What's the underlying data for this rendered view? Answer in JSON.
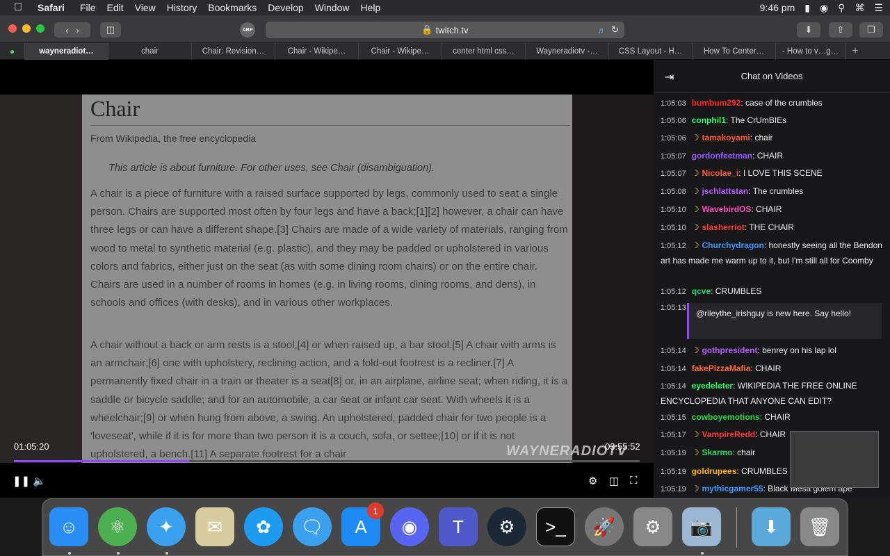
{
  "menubar": {
    "app": "Safari",
    "items": [
      "File",
      "Edit",
      "View",
      "History",
      "Bookmarks",
      "Develop",
      "Window",
      "Help"
    ],
    "clock": "9:46 pm"
  },
  "toolbar": {
    "url": "twitch.tv",
    "abp": "ABP"
  },
  "tabs": [
    {
      "label": "wayneradiot…",
      "active": true
    },
    {
      "label": "chair"
    },
    {
      "label": "Chair: Revision…"
    },
    {
      "label": "Chair - Wikipe…"
    },
    {
      "label": "Chair - Wikipe…"
    },
    {
      "label": "center html css…"
    },
    {
      "label": "Wayneradiotv -…"
    },
    {
      "label": "CSS Layout - H…"
    },
    {
      "label": "How To Center…"
    },
    {
      "label": "- How to v…g…"
    }
  ],
  "video": {
    "page_title": "Chair",
    "page_sub": "From Wikipedia, the free encyclopedia",
    "page_note": "This article is about furniture. For other uses, see Chair (disambiguation).",
    "para1": "A chair is a piece of furniture with a raised surface supported by legs, commonly used to seat a single person. Chairs are supported most often by four legs and have a back;[1][2] however, a chair can have three legs or can have a different shape.[3] Chairs are made of a wide variety of materials, ranging from wood to metal to synthetic material (e.g. plastic), and they may be padded or upholstered in various colors and fabrics, either just on the seat (as with some dining room chairs) or on the entire chair. Chairs are used in a number of rooms in homes (e.g. in living rooms, dining rooms, and dens), in schools and offices (with desks), and in various other workplaces.",
    "para2": "A chair without a back or arm rests is a stool,[4] or when raised up, a bar stool.[5] A chair with arms is an armchair;[6] one with upholstery, reclining action, and a fold-out footrest is a recliner.[7] A permanently fixed chair in a train or theater is a seat[8] or, in an airplane, airline seat; when riding, it is a saddle or bicycle saddle; and for an automobile, a car seat or infant car seat. With wheels it is a wheelchair;[9] or when hung from above, a swing. An upholstered, padded chair for two people is a 'loveseat', while if it is for more than two person it is a couch, sofa, or settee;[10] or if it is not upholstered, a bench.[11] A separate footrest for a chair",
    "watermark": "WAYNERADIOTV",
    "time_current": "01:05:20",
    "time_total": "03:55:52",
    "progress": 0.28
  },
  "chat": {
    "title": "Chat on Videos",
    "messages": [
      {
        "time": "1:05:03",
        "user": "bumbum292",
        "color": "#ff2b2b",
        "text": "case of the crumbles",
        "badge": false
      },
      {
        "time": "1:05:06",
        "user": "conphil1",
        "color": "#2bff6b",
        "text": "The CrUmBIEs",
        "badge": false
      },
      {
        "time": "1:05:06",
        "user": "tamakoyami",
        "color": "#ff5a2b",
        "text": "chair",
        "badge": true
      },
      {
        "time": "1:05:07",
        "user": "gordonfeetman",
        "color": "#9c5bff",
        "text": "CHAIR",
        "badge": false
      },
      {
        "time": "1:05:07",
        "user": "Nicolae_i",
        "color": "#ff5a2b",
        "text": "I LOVE THIS SCENE",
        "badge": true
      },
      {
        "time": "1:05:08",
        "user": "jschlattstan",
        "color": "#b65cff",
        "text": "The crumbles",
        "badge": true
      },
      {
        "time": "1:05:10",
        "user": "WavebirdOS",
        "color": "#ff4fc3",
        "text": "CHAIR",
        "badge": true
      },
      {
        "time": "1:05:10",
        "user": "slasherriot",
        "color": "#ff3b3b",
        "text": "THE CHAIR",
        "badge": true
      },
      {
        "time": "1:05:12",
        "user": "Churchydragon",
        "color": "#3b9cff",
        "text": "honestly seeing all the Bendon art has made me warm up to it, but I'm still all for Coomby",
        "badge": true
      },
      {
        "time": "1:05:12",
        "user": "qcve",
        "color": "#2bdc6b",
        "text": "CRUMBLES",
        "badge": false
      },
      {
        "time": "1:05:13",
        "user": "",
        "color": "#fff",
        "text": "",
        "badge": false
      },
      {
        "time": "1:05:14",
        "user": "gothpresident",
        "color": "#b65cff",
        "text": "benrey on his lap lol",
        "badge": true
      },
      {
        "time": "1:05:14",
        "user": "fakePizzaMafia",
        "color": "#ff6b3b",
        "text": "CHAIR",
        "badge": false
      },
      {
        "time": "1:05:14",
        "user": "eyedeleter",
        "color": "#2bff6b",
        "text": "WIKIPEDIA THE FREE ONLINE ENCYCLOPEDIA THAT ANYONE CAN EDIT?",
        "badge": false
      },
      {
        "time": "1:05:15",
        "user": "cowboyemotions",
        "color": "#2bdc4b",
        "text": "CHAIR",
        "badge": false
      },
      {
        "time": "1:05:17",
        "user": "VampireRedd",
        "color": "#ff3b3b",
        "text": "CHAIR",
        "badge": true
      },
      {
        "time": "1:05:19",
        "user": "Skarmo",
        "color": "#2bdc6b",
        "text": "chair",
        "badge": true
      },
      {
        "time": "1:05:19",
        "user": "goldrupees",
        "color": "#ffb700",
        "text": "CRUMBLES",
        "badge": false
      },
      {
        "time": "1:05:19",
        "user": "mythicgamer55",
        "color": "#3b9cff",
        "text": "Black Mesa golem ape",
        "badge": true
      }
    ],
    "raid_text": "@rileythe_irishguy is new here. Say hello!"
  },
  "dock": {
    "apps": [
      "Finder",
      "Atom",
      "Safari",
      "Mail",
      "Twitter",
      "Messages",
      "App Store",
      "Discord",
      "Teams",
      "Steam",
      "Terminal",
      "Launchpad",
      "System Preferences",
      "Preview",
      "Downloads",
      "Trash"
    ],
    "appstore_badge": "1"
  }
}
